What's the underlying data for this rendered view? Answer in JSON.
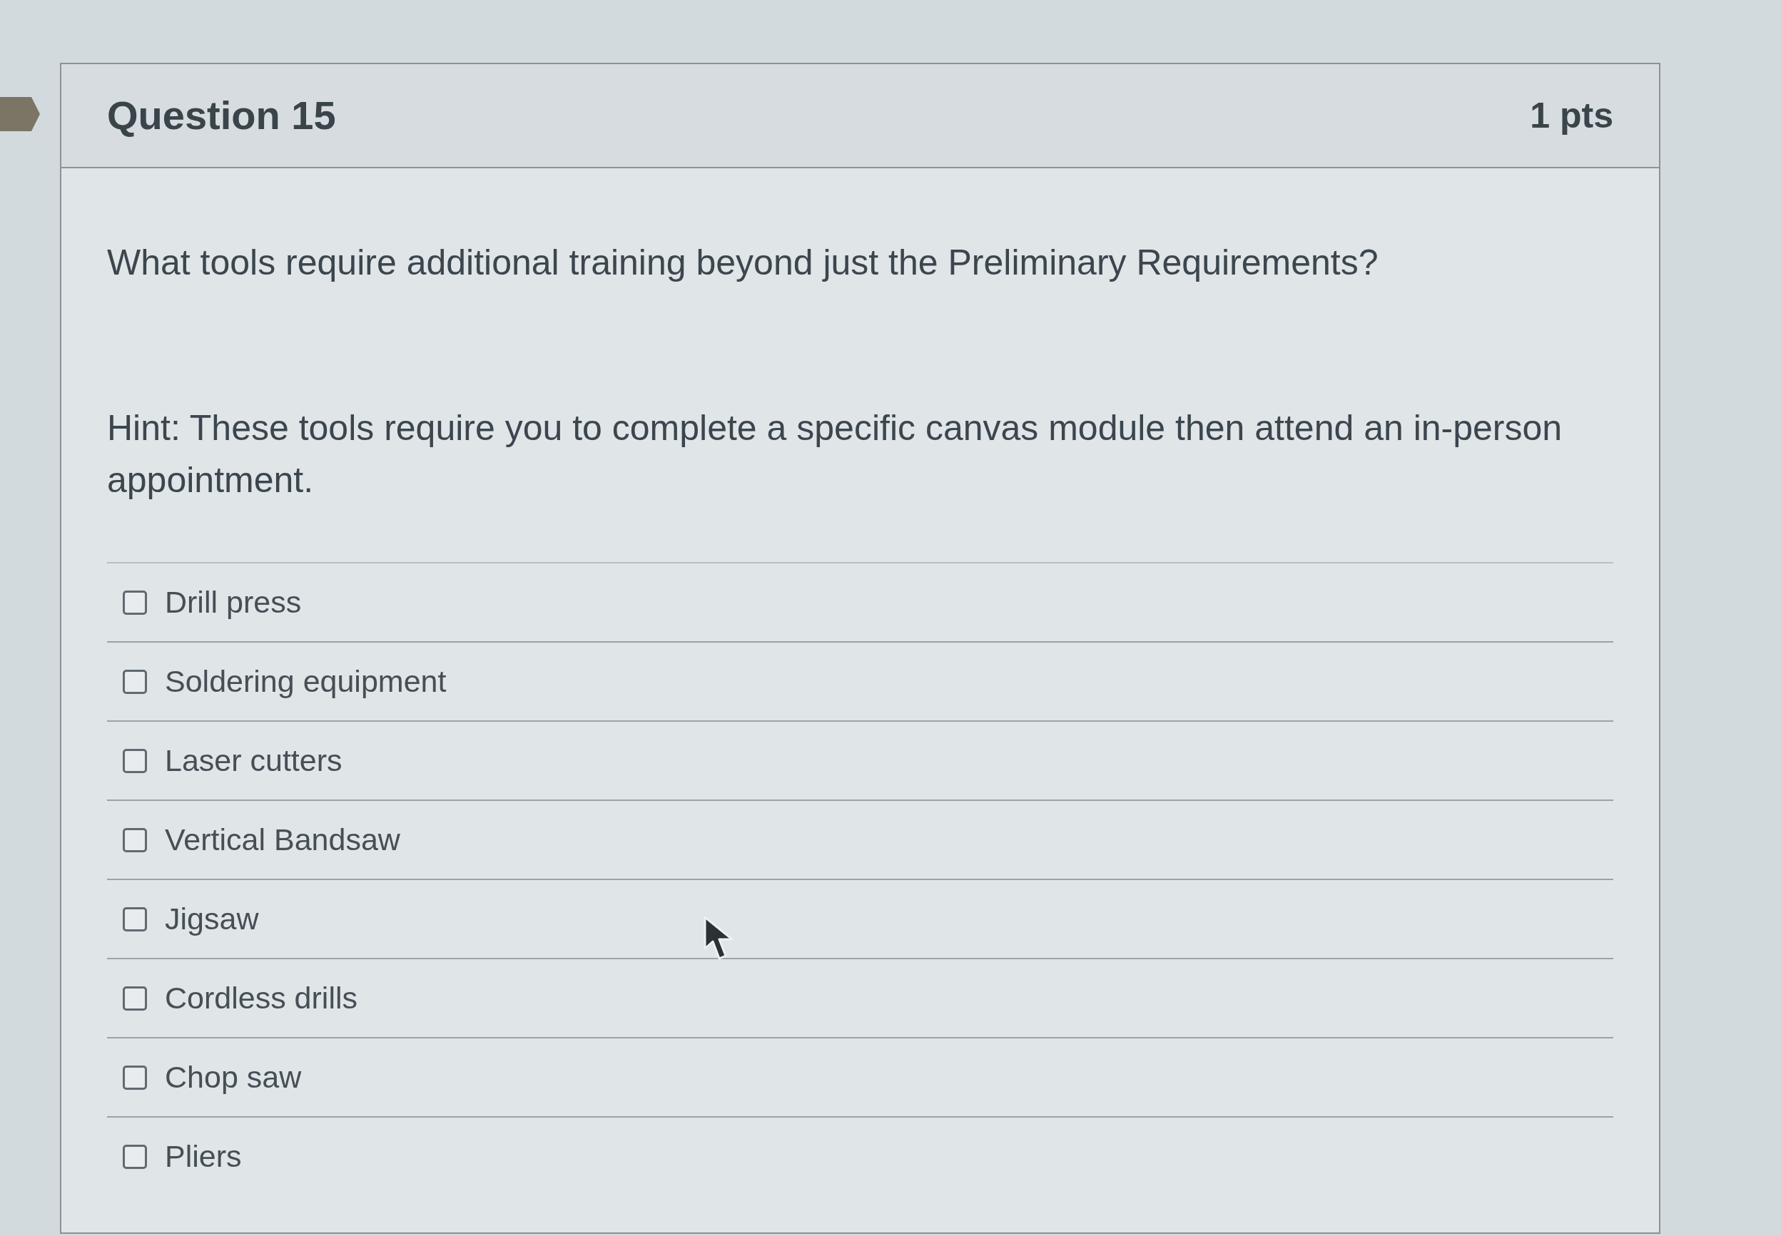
{
  "question": {
    "title": "Question 15",
    "points": "1 pts",
    "text": "What tools require additional training beyond just the Preliminary Requirements?",
    "hint": "Hint: These tools require you to complete a specific canvas module then attend an in-person appointment."
  },
  "answers": [
    {
      "label": "Drill press",
      "checked": false
    },
    {
      "label": "Soldering equipment",
      "checked": false
    },
    {
      "label": "Laser cutters",
      "checked": false
    },
    {
      "label": "Vertical Bandsaw",
      "checked": false
    },
    {
      "label": "Jigsaw",
      "checked": false
    },
    {
      "label": "Cordless drills",
      "checked": false
    },
    {
      "label": "Chop saw",
      "checked": false
    },
    {
      "label": "Pliers",
      "checked": false
    }
  ]
}
